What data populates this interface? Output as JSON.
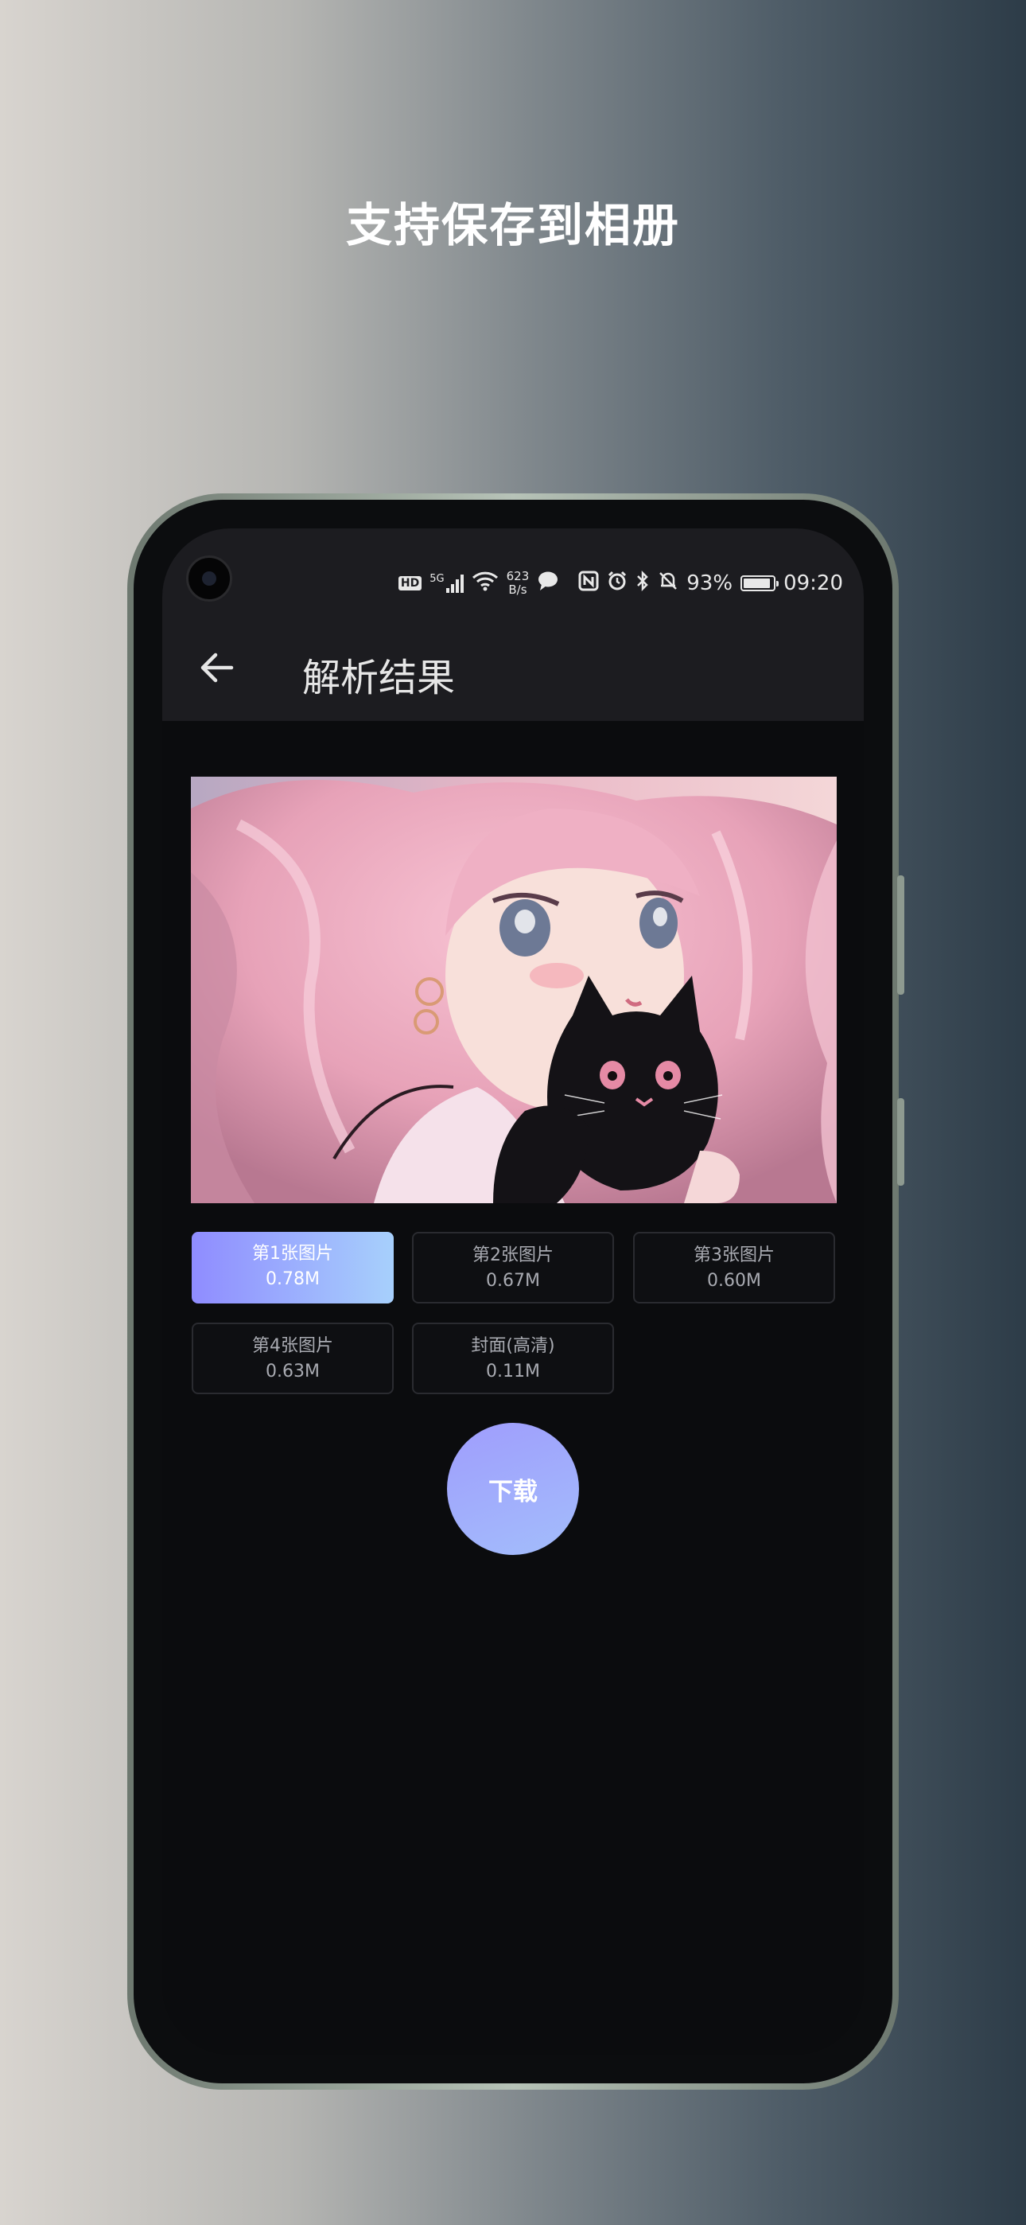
{
  "promo": {
    "headline": "支持保存到相册"
  },
  "status_bar": {
    "hd_badge": "HD",
    "network_gen": "5G",
    "net_speed_value": "623",
    "net_speed_unit": "B/s",
    "battery_percent": "93%",
    "battery_level": 0.93,
    "time": "09:20",
    "icons": [
      "camera-icon",
      "signal-icon",
      "wifi-icon",
      "chat-icon",
      "nfc-icon",
      "alarm-icon",
      "bluetooth-icon",
      "mute-bell-icon",
      "battery-icon"
    ]
  },
  "header": {
    "back_icon": "arrow-left-icon",
    "title": "解析结果"
  },
  "carousel": {
    "page_count": 5,
    "active_index": 1
  },
  "images": [
    {
      "label": "第1张图片",
      "size": "0.78M",
      "selected": true
    },
    {
      "label": "第2张图片",
      "size": "0.67M",
      "selected": false
    },
    {
      "label": "第3张图片",
      "size": "0.60M",
      "selected": false
    },
    {
      "label": "第4张图片",
      "size": "0.63M",
      "selected": false
    },
    {
      "label": "封面(高清)",
      "size": "0.11M",
      "selected": false
    }
  ],
  "actions": {
    "download_label": "下载"
  },
  "colors": {
    "accent_start": "#8f8cff",
    "accent_end": "#a7d0fc",
    "active_dot": "#ef4f3c",
    "screen_bg": "#0b0c0e",
    "bar_bg": "#1c1c20"
  }
}
